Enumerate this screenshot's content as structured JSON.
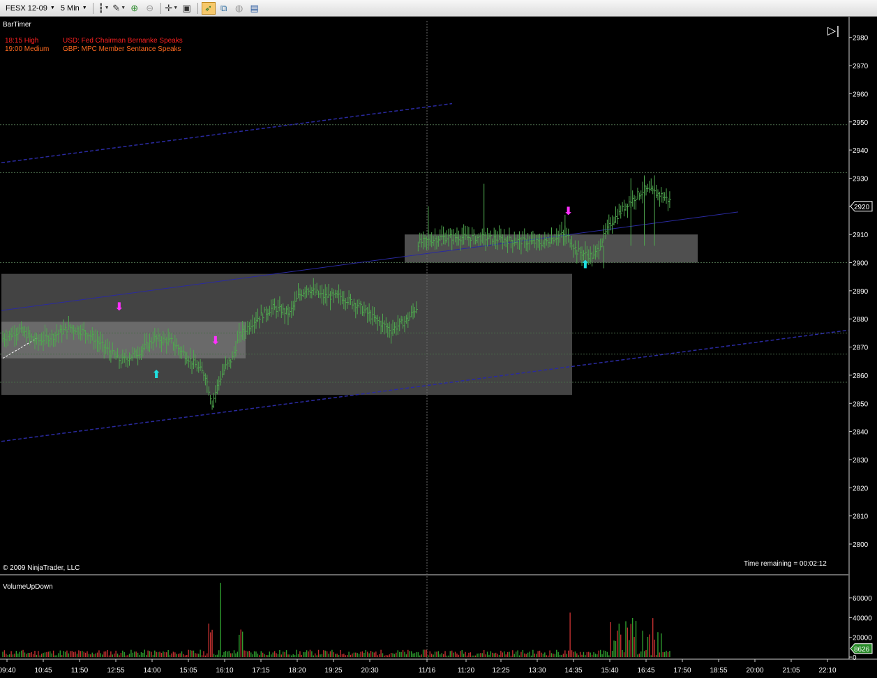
{
  "toolbar": {
    "instrument": "FESX 12-09",
    "interval": "5 Min",
    "icons": [
      "bar-type-icon",
      "draw-tool-icon",
      "zoom-in-icon",
      "zoom-out-icon",
      "crosshair-icon",
      "properties-icon",
      "strategy-icon",
      "indicators-icon",
      "replay-icon",
      "data-box-icon"
    ]
  },
  "indicator_label": "BarTimer",
  "news": [
    {
      "time": "18:15 High",
      "text": "USD: Fed Chairman Bernanke Speaks",
      "level": "high"
    },
    {
      "time": "19:00 Medium",
      "text": "GBP: MPC Member Sentance Speaks",
      "level": "medium"
    }
  ],
  "copyright": "© 2009 NinjaTrader, LLC",
  "time_remaining": "Time remaining = 00:02:12",
  "volume_label": "VolumeUpDown",
  "last_price_label": "2920",
  "last_volume_label": "8626",
  "colors": {
    "up_bar": "#4fa84f",
    "volume_up": "#2e9c2e",
    "volume_down": "#c23030",
    "trendline": "#2a2aa0",
    "zone": "#5a5a5a",
    "buy_arrow": "#20e0e0",
    "sell_arrow": "#ff30ff"
  },
  "chart_data": [
    {
      "type": "candlestick",
      "title": "",
      "y_ticks": [
        2800,
        2810,
        2820,
        2830,
        2840,
        2850,
        2860,
        2870,
        2880,
        2890,
        2900,
        2910,
        2920,
        2930,
        2940,
        2950,
        2960,
        2970,
        2980
      ],
      "ylim": [
        2795,
        2986
      ],
      "x_ticks": [
        "09:40",
        "10:45",
        "11:50",
        "12:55",
        "14:00",
        "15:05",
        "16:10",
        "17:15",
        "18:20",
        "19:25",
        "20:30",
        "11/16",
        "11:20",
        "12:25",
        "13:30",
        "14:35",
        "15:40",
        "16:45",
        "17:50",
        "18:55",
        "20:00",
        "21:05",
        "22:10"
      ],
      "last_price": 2920,
      "horizontal_levels": [
        2949,
        2932,
        2900,
        2875,
        2867.5,
        2857.5
      ],
      "price_path": [
        [
          0,
          2873
        ],
        [
          10,
          2876
        ],
        [
          20,
          2872
        ],
        [
          30,
          2874
        ],
        [
          40,
          2877
        ],
        [
          50,
          2875
        ],
        [
          60,
          2870
        ],
        [
          70,
          2865
        ],
        [
          80,
          2868
        ],
        [
          90,
          2873
        ],
        [
          100,
          2872
        ],
        [
          110,
          2866
        ],
        [
          120,
          2860
        ],
        [
          124,
          2850
        ],
        [
          128,
          2858
        ],
        [
          132,
          2863
        ],
        [
          136,
          2866
        ],
        [
          140,
          2874
        ],
        [
          150,
          2880
        ],
        [
          160,
          2884
        ],
        [
          170,
          2882
        ],
        [
          175,
          2888
        ],
        [
          180,
          2891
        ],
        [
          190,
          2888
        ],
        [
          200,
          2888
        ],
        [
          210,
          2885
        ],
        [
          220,
          2880
        ],
        [
          230,
          2876
        ],
        [
          240,
          2880
        ],
        [
          245,
          2884
        ],
        [
          246,
          2907
        ],
        [
          260,
          2909
        ],
        [
          280,
          2909
        ],
        [
          300,
          2908
        ],
        [
          320,
          2907
        ],
        [
          330,
          2910
        ],
        [
          335,
          2909
        ],
        [
          340,
          2904
        ],
        [
          350,
          2902
        ],
        [
          355,
          2908
        ],
        [
          360,
          2914
        ],
        [
          370,
          2921
        ],
        [
          380,
          2926
        ],
        [
          390,
          2924
        ],
        [
          395,
          2922
        ]
      ]
    },
    {
      "type": "bar",
      "title": "VolumeUpDown",
      "y_ticks": [
        0,
        20000,
        40000,
        60000
      ],
      "last_value": 8626
    }
  ]
}
